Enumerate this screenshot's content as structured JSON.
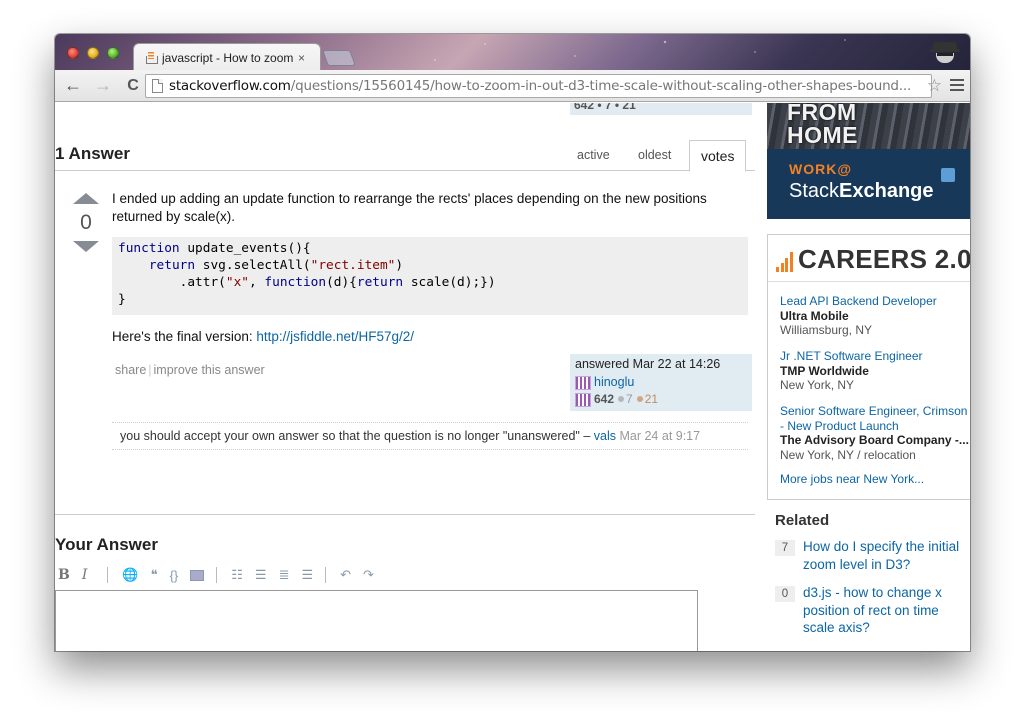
{
  "browser": {
    "tab_title": "javascript - How to zoom i",
    "tab_close": "×",
    "url_host": "stackoverflow.com",
    "url_path": "/questions/15560145/how-to-zoom-in-out-d3-time-scale-without-scaling-other-shapes-bound...",
    "back_glyph": "←",
    "forward_glyph": "→",
    "reload_glyph": "C",
    "star_glyph": "☆"
  },
  "question_sig": {
    "rep": "642 • 7 • 21"
  },
  "answers": {
    "title": "1 Answer",
    "tabs": {
      "active": "active",
      "oldest": "oldest",
      "votes": "votes"
    }
  },
  "answer": {
    "votes": "0",
    "text": "I ended up adding an update function to rearrange the rects' places depending on the new positions returned by scale(x).",
    "final_prefix": "Here's the final version: ",
    "final_link": "http://jsfiddle.net/HF57g/2/",
    "share": "share",
    "improve": "improve this answer",
    "answered": "answered Mar 22 at 14:26",
    "user": "hinoglu",
    "rep": "642",
    "silver": "7",
    "bronze": "21"
  },
  "code": {
    "line1_kw": "function",
    "line1_rest": " update_events(){",
    "line2_kw": "return",
    "line2_a": " svg.selectAll(",
    "line2_str": "\"rect.item\"",
    "line2_b": ")",
    "line3_a": ".attr(",
    "line3_str": "\"x\"",
    "line3_b": ", ",
    "line3_kw": "function",
    "line3_c": "(d){",
    "line3_kw2": "return",
    "line3_d": " scale(d);})",
    "line4": "}"
  },
  "comment": {
    "text": "you should accept your own answer so that the question is no longer \"unanswered\" –",
    "user": "vals",
    "time": "Mar 24 at 9:17"
  },
  "your_answer": {
    "title": "Your Answer"
  },
  "editor": {
    "bold": "B",
    "italic": "I",
    "quote": "❝",
    "code": "{}",
    "olist": "☷",
    "ulist": "☰",
    "heading": "≣",
    "hr": "☰",
    "undo": "↶",
    "redo": "↷"
  },
  "ad": {
    "from": "FROM",
    "home": "HOME",
    "work": "WORK@",
    "brand_a": "Stack",
    "brand_b": "Exchange"
  },
  "careers": {
    "title": "CAREERS 2.0",
    "jobs": [
      {
        "title": "Lead API Backend Developer",
        "company": "Ultra Mobile",
        "location": "Williamsburg, NY"
      },
      {
        "title": "Jr .NET Software Engineer",
        "company": "TMP Worldwide",
        "location": "New York, NY"
      },
      {
        "title": "Senior Software Engineer, Crimson - New Product Launch",
        "company": "The Advisory Board Company -...",
        "location": "New York, NY / relocation"
      }
    ],
    "more": "More jobs near New York..."
  },
  "related": {
    "title": "Related",
    "items": [
      {
        "count": "7",
        "title": "How do I specify the initial zoom level in D3?"
      },
      {
        "count": "0",
        "title": "d3.js - how to change x position of rect on time scale axis?"
      }
    ]
  }
}
